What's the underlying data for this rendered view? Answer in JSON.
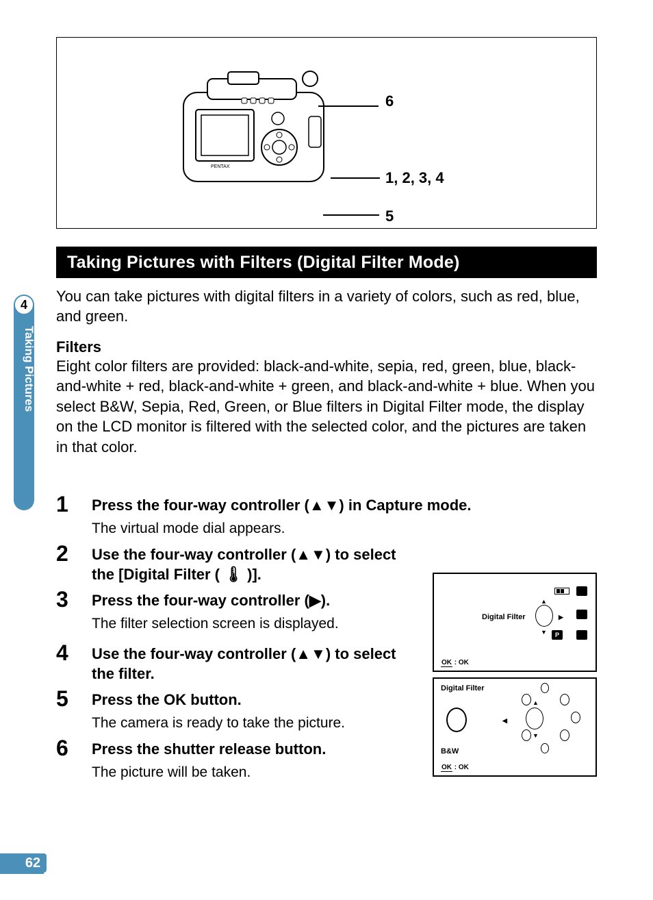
{
  "page_number": "62",
  "side_tab": {
    "number": "4",
    "label": "Taking Pictures"
  },
  "diagram": {
    "callouts": {
      "top": "6",
      "mid": "1, 2, 3, 4",
      "bottom": "5"
    }
  },
  "heading": "Taking Pictures with Filters (Digital Filter Mode)",
  "intro": "You can take pictures with digital filters in a variety of colors, such as red, blue, and green.",
  "filters_heading": "Filters",
  "filters_body": "Eight color filters are provided: black-and-white, sepia, red, green, blue, black-and-white + red, black-and-white + green, and black-and-white + blue. When you select B&W, Sepia, Red, Green, or Blue filters in Digital Filter mode, the display on the LCD monitor is filtered with the selected color, and the pictures are taken in that color.",
  "steps": [
    {
      "num": "1",
      "title": "Press the four-way controller (▲▼) in Capture mode.",
      "desc": "The virtual mode dial appears."
    },
    {
      "num": "2",
      "title": "Use the four-way controller (▲▼) to select the [Digital Filter ( 🌡 )].",
      "desc": ""
    },
    {
      "num": "3",
      "title": "Press the four-way controller (▶).",
      "desc": "The filter selection screen is displayed."
    },
    {
      "num": "4",
      "title": "Use the four-way controller (▲▼) to select the filter.",
      "desc": ""
    },
    {
      "num": "5",
      "title": "Press the OK button.",
      "desc": "The camera is ready to take the picture."
    },
    {
      "num": "6",
      "title": "Press the shutter release button.",
      "desc": "The picture will be taken."
    }
  ],
  "lcd1": {
    "label": "Digital Filter",
    "ok": "OK",
    "ok_colon": " : OK"
  },
  "lcd2": {
    "heading": "Digital Filter",
    "filter_name": "B&W",
    "ok": "OK",
    "ok_colon": " : OK"
  }
}
